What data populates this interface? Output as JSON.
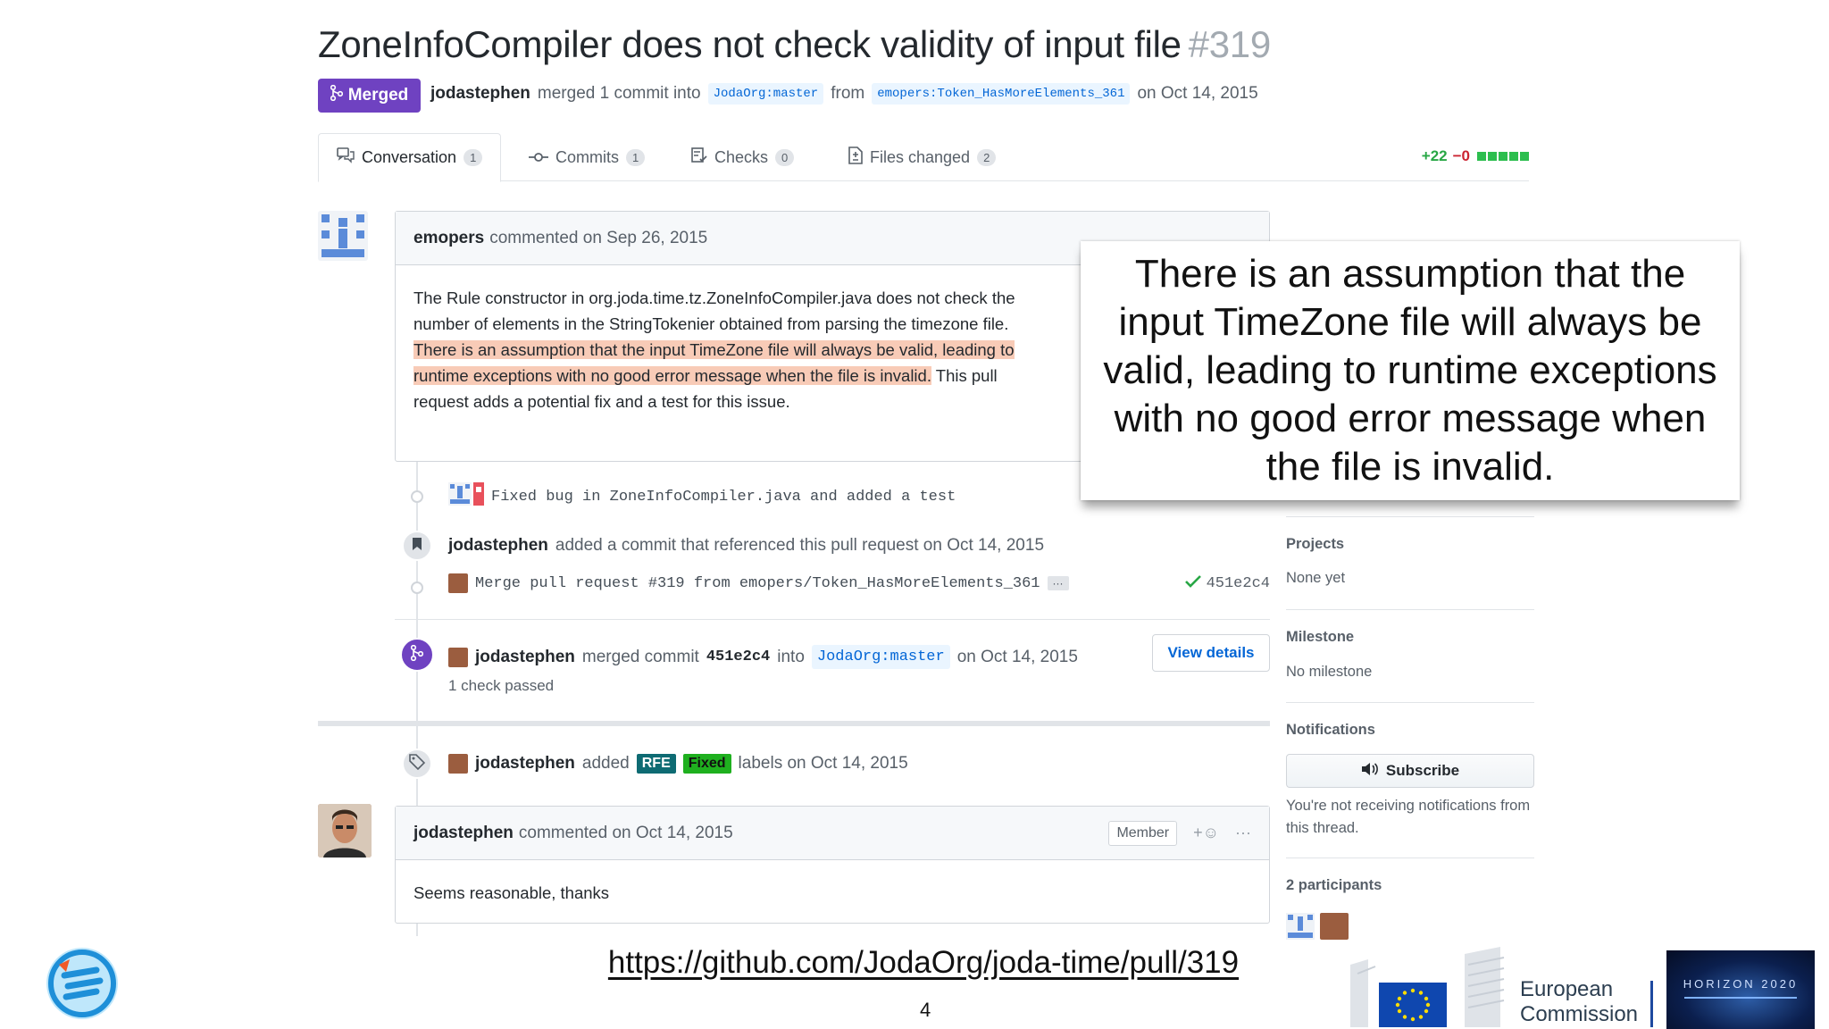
{
  "pr": {
    "title": "ZoneInfoCompiler does not check validity of input file",
    "number": "#319",
    "state": "Merged",
    "author": "jodastephen",
    "merged_text": "merged 1 commit into",
    "base_branch": "JodaOrg:master",
    "from_text": "from",
    "head_branch": "emopers:Token_HasMoreElements_361",
    "date_text": "on Oct 14, 2015"
  },
  "tabs": [
    {
      "label": "Conversation",
      "count": "1"
    },
    {
      "label": "Commits",
      "count": "1"
    },
    {
      "label": "Checks",
      "count": "0"
    },
    {
      "label": "Files changed",
      "count": "2"
    }
  ],
  "diffstat": {
    "additions": "+22",
    "deletions": "−0"
  },
  "comment1": {
    "author": "emopers",
    "meta": "commented on Sep 26, 2015",
    "text_a": "The Rule constructor in org.joda.time.tz.ZoneInfoCompiler.java does not check the number of elements in the StringTokenier obtained from parsing the timezone file. ",
    "text_hl": "There is an assumption that the input TimeZone file will always be valid, leading to runtime exceptions with no good error message when the file is invalid.",
    "text_b": " This pull request adds a potential fix and a test for this issue."
  },
  "commit1": {
    "message": "Fixed bug in ZoneInfoCompiler.java and added a test"
  },
  "ref_event": {
    "author": "jodastephen",
    "text": "added a commit that referenced this pull request on Oct 14, 2015"
  },
  "ref_commit": {
    "message": "Merge pull request #319 from emopers/Token_HasMoreElements_361",
    "ellipsis": "···",
    "sha": "451e2c4"
  },
  "merge_event": {
    "author": "jodastephen",
    "text1": "merged commit",
    "sha": "451e2c4",
    "text2": "into",
    "branch": "JodaOrg:master",
    "date": "on Oct 14, 2015",
    "checks": "1 check passed",
    "button": "View details"
  },
  "label_event": {
    "author": "jodastephen",
    "text1": "added",
    "labels": [
      {
        "name": "RFE",
        "color": "#0e6b73"
      },
      {
        "name": "Fixed",
        "color": "#1fb01f"
      }
    ],
    "text2": "labels on Oct 14, 2015"
  },
  "comment2": {
    "author": "jodastephen",
    "meta": "commented on Oct 14, 2015",
    "badge": "Member",
    "reaction": "+☺",
    "more": "···",
    "text": "Seems reasonable, thanks"
  },
  "sidebar": {
    "projects_title": "Projects",
    "projects_value": "None yet",
    "milestone_title": "Milestone",
    "milestone_value": "No milestone",
    "notifications_title": "Notifications",
    "subscribe_label": "Subscribe",
    "notifications_note": "You're not receiving notifications from this thread.",
    "participants_title": "2 participants"
  },
  "callout": {
    "text": "There is an assumption that the input TimeZone file will always be valid, leading to runtime exceptions with no good error message when the file is invalid."
  },
  "footer": {
    "url": "https://github.com/JodaOrg/joda-time/pull/319",
    "page_number": "4",
    "ec_line1": "European",
    "ec_line2": "Commission",
    "horizon": "HORIZON 2020"
  },
  "colors": {
    "merged": "#6f42c1",
    "highlight": "#f8cbb7",
    "link": "#0366d6",
    "success": "#28a745"
  }
}
